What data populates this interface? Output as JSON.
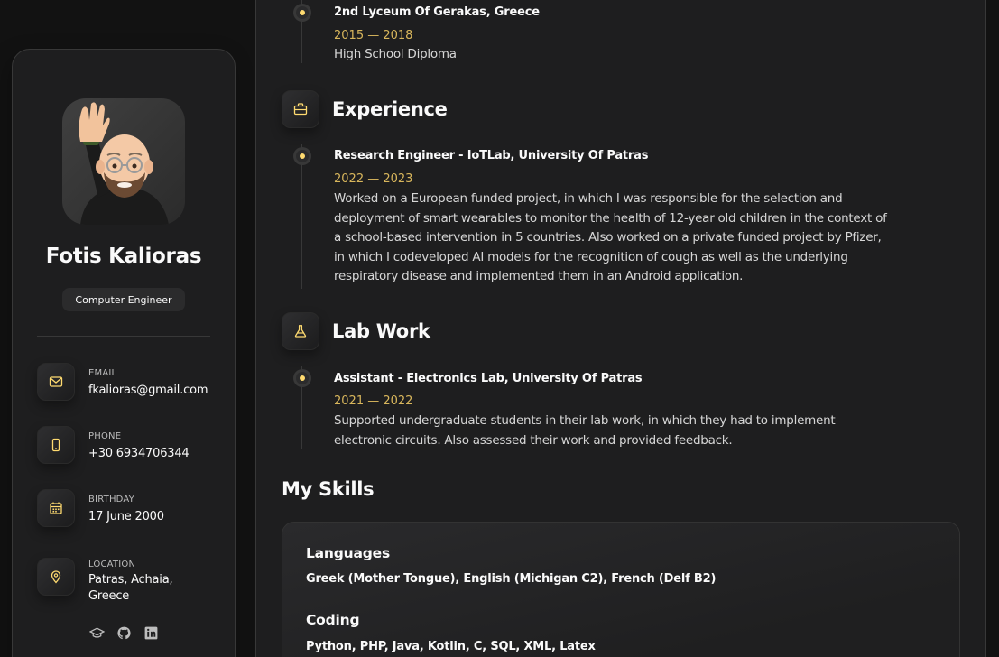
{
  "profile": {
    "name": "Fotis Kalioras",
    "title": "Computer Engineer"
  },
  "contacts": {
    "email": {
      "label": "EMAIL",
      "value": "fkalioras@gmail.com"
    },
    "phone": {
      "label": "PHONE",
      "value": "+30 6934706344"
    },
    "birthday": {
      "label": "BIRTHDAY",
      "value": "17 June 2000"
    },
    "location": {
      "label": "LOCATION",
      "value_line1": "Patras, Achaia,",
      "value_line2": "Greece"
    }
  },
  "socials": [
    "graduation-cap-icon",
    "github-icon",
    "linkedin-icon"
  ],
  "education_item": {
    "title": "2nd Lyceum Of Gerakas, Greece",
    "date": "2015 — 2018",
    "text": "High School Diploma"
  },
  "experience": {
    "heading": "Experience",
    "item": {
      "title": "Research Engineer - IoTLab, University Of Patras",
      "date": "2022 — 2023",
      "lines": [
        "Worked on a European funded project, in which I was responsible for the selection and",
        "deployment of smart wearables to monitor the health of 12-year old children in the context of",
        "a school-based intervention in 5 countries. Also worked on a private funded project by Pfizer,",
        "in which I codeveloped AI models for the recognition of cough as well as the underlying",
        "respiratory disease and implemented them in an Android application."
      ]
    }
  },
  "labwork": {
    "heading": "Lab Work",
    "item": {
      "title": "Assistant - Electronics Lab, University Of Patras",
      "date": "2021 — 2022",
      "lines": [
        "Supported undergraduate students in their lab work, in which they had to implement",
        "electronic circuits. Also assessed their work and provided feedback."
      ]
    }
  },
  "skills": {
    "heading": "My Skills",
    "languages": {
      "label": "Languages",
      "value": "Greek (Mother Tongue), English (Michigan C2), French (Delf B2)"
    },
    "coding": {
      "label": "Coding",
      "value": "Python, PHP, Java, Kotlin, C, SQL, XML, Latex"
    }
  },
  "colors": {
    "accent": "#ffdb70",
    "date": "#d8b65c",
    "background": "#121212",
    "panel": "#1e1e1f"
  }
}
